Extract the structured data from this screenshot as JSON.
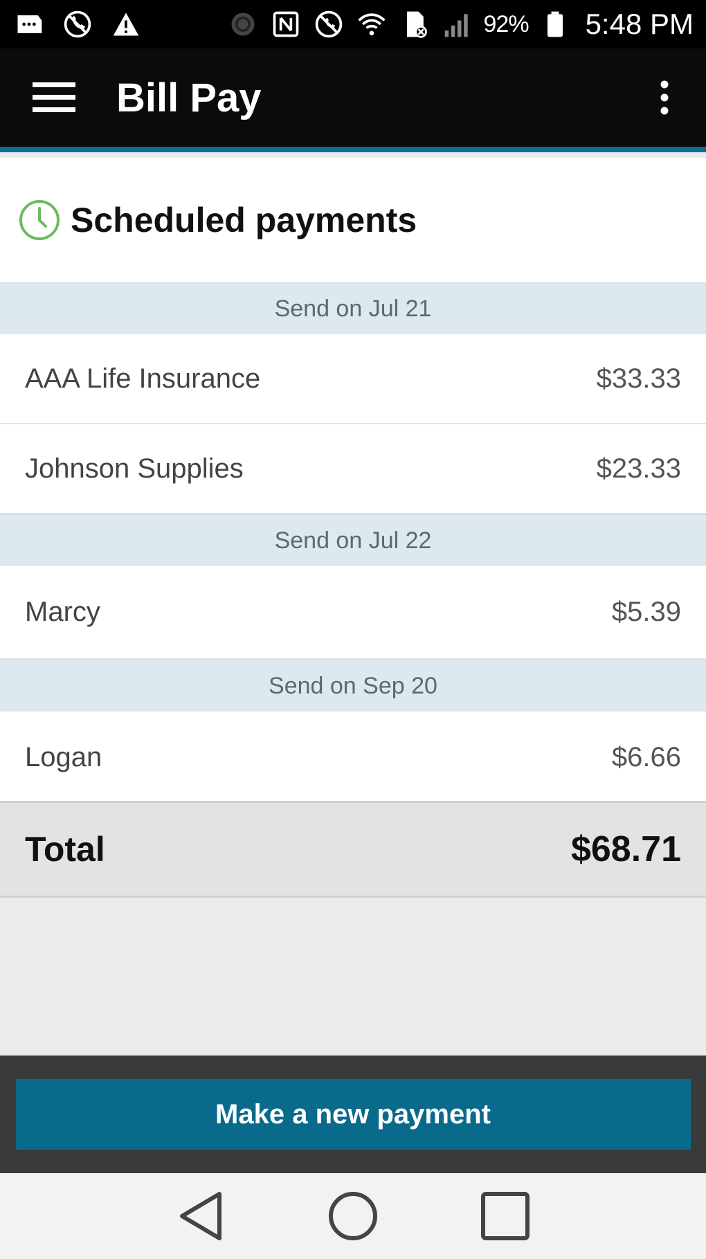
{
  "status_bar": {
    "icons": [
      "message-icon",
      "no-call-icon",
      "warning-icon",
      "sync-icon",
      "nfc-icon",
      "blocked-icon",
      "wifi-icon",
      "sd-card-icon",
      "signal-icon",
      "battery-icon"
    ],
    "battery": "92%",
    "time": "5:48 PM"
  },
  "app_bar": {
    "title": "Bill Pay"
  },
  "section": {
    "title": "Scheduled payments",
    "icon_color": "#6dba5f"
  },
  "groups": [
    {
      "label": "Send on Jul 21",
      "payments": [
        {
          "payee": "AAA Life Insurance",
          "amount": "$33.33"
        },
        {
          "payee": "Johnson Supplies",
          "amount": "$23.33"
        }
      ]
    },
    {
      "label": "Send on Jul 22",
      "payments": [
        {
          "payee": "Marcy",
          "amount": "$5.39"
        }
      ]
    },
    {
      "label": "Send on Sep 20",
      "payments": [
        {
          "payee": "Logan",
          "amount": "$6.66"
        }
      ]
    }
  ],
  "total": {
    "label": "Total",
    "amount": "$68.71"
  },
  "actions": {
    "new_payment_label": "Make a new payment"
  },
  "colors": {
    "accent": "#0a6a8c",
    "group_header_bg": "#dde9ee"
  }
}
